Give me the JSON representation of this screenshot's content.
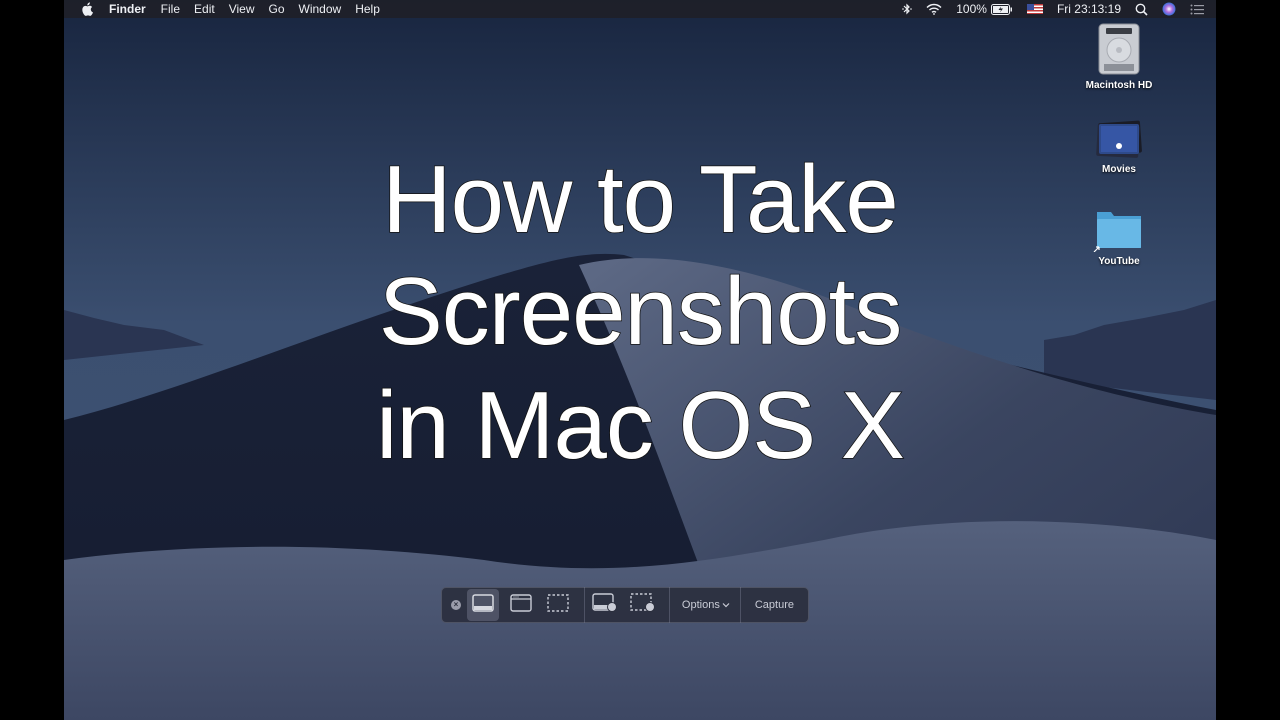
{
  "menubar": {
    "apple_icon": "apple-logo-icon",
    "app_name": "Finder",
    "menus": [
      "File",
      "Edit",
      "View",
      "Go",
      "Window",
      "Help"
    ],
    "status": {
      "bluetooth_icon": "bluetooth-icon",
      "wifi_icon": "wifi-icon",
      "battery_percent": "100%",
      "battery_icon": "battery-charging-icon",
      "input_source": "US flag",
      "clock": "Fri 23:13:19",
      "spotlight_icon": "search-icon",
      "siri_icon": "siri-icon",
      "notification_icon": "notification-center-icon"
    }
  },
  "overlay_title": {
    "line1": "How to Take",
    "line2": "Screenshots",
    "line3": "in Mac OS X"
  },
  "desktop_icons": [
    {
      "label": "Macintosh HD",
      "icon": "hard-drive-icon"
    },
    {
      "label": "Movies",
      "icon": "movies-folder-icon"
    },
    {
      "label": "YouTube",
      "icon": "folder-alias-icon"
    }
  ],
  "screenshot_toolbar": {
    "close_icon": "close-icon",
    "tools": [
      {
        "name": "Capture Entire Screen",
        "icon": "entire-screen-icon",
        "selected": true
      },
      {
        "name": "Capture Selected Window",
        "icon": "window-icon",
        "selected": false
      },
      {
        "name": "Capture Selected Portion",
        "icon": "selection-icon",
        "selected": false
      },
      {
        "name": "Record Entire Screen",
        "icon": "record-screen-icon",
        "selected": false
      },
      {
        "name": "Record Selected Portion",
        "icon": "record-selection-icon",
        "selected": false
      }
    ],
    "options_label": "Options",
    "capture_label": "Capture"
  }
}
